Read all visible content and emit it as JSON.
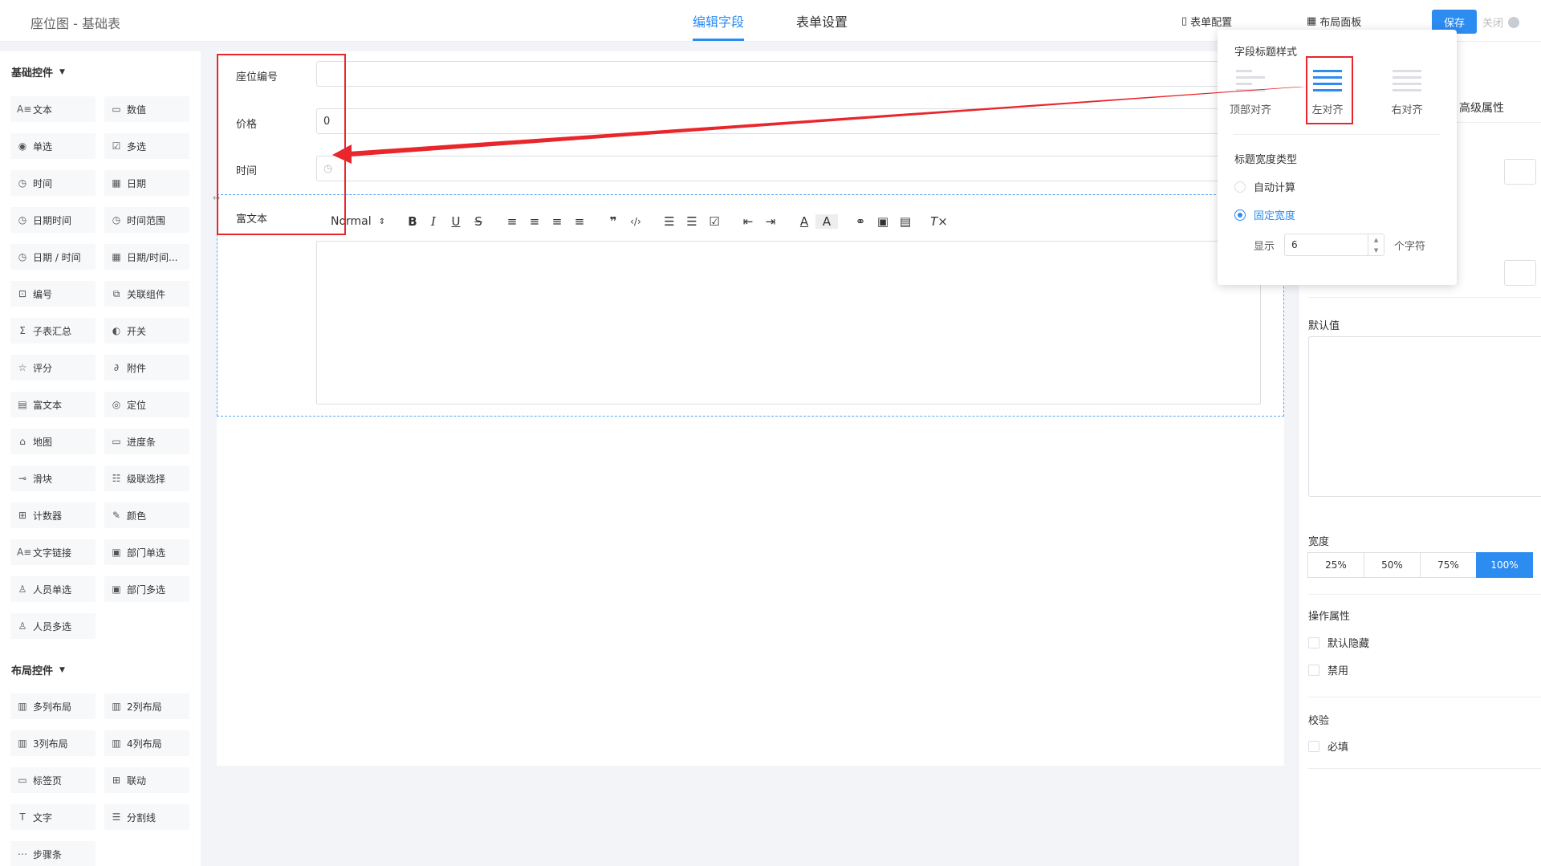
{
  "header": {
    "title": "座位图 - 基础表",
    "tabs": [
      "编辑字段",
      "表单设置"
    ],
    "form_config": "表单配置",
    "layout_panel": "布局面板",
    "save": "保存",
    "close": "关闭"
  },
  "sidebar": {
    "basic_group": "基础控件",
    "basic_items": [
      {
        "label": "文本",
        "icon": "text-icon"
      },
      {
        "label": "数值",
        "icon": "number-icon"
      },
      {
        "label": "单选",
        "icon": "radio-icon"
      },
      {
        "label": "多选",
        "icon": "checkbox-icon"
      },
      {
        "label": "时间",
        "icon": "clock-icon"
      },
      {
        "label": "日期",
        "icon": "calendar-icon"
      },
      {
        "label": "日期时间",
        "icon": "clock-icon"
      },
      {
        "label": "时间范围",
        "icon": "clock-icon"
      },
      {
        "label": "日期 / 时间",
        "icon": "clock-icon"
      },
      {
        "label": "日期/时间...",
        "icon": "calendar-icon"
      },
      {
        "label": "编号",
        "icon": "serial-icon"
      },
      {
        "label": "关联组件",
        "icon": "link-component-icon"
      },
      {
        "label": "子表汇总",
        "icon": "sigma-icon"
      },
      {
        "label": "开关",
        "icon": "toggle-icon"
      },
      {
        "label": "评分",
        "icon": "star-icon"
      },
      {
        "label": "附件",
        "icon": "paperclip-icon"
      },
      {
        "label": "富文本",
        "icon": "richtext-icon"
      },
      {
        "label": "定位",
        "icon": "location-icon"
      },
      {
        "label": "地图",
        "icon": "map-icon"
      },
      {
        "label": "进度条",
        "icon": "progress-icon"
      },
      {
        "label": "滑块",
        "icon": "slider-icon"
      },
      {
        "label": "级联选择",
        "icon": "cascade-icon"
      },
      {
        "label": "计数器",
        "icon": "counter-icon"
      },
      {
        "label": "颜色",
        "icon": "color-picker-icon"
      },
      {
        "label": "文字链接",
        "icon": "text-link-icon"
      },
      {
        "label": "部门单选",
        "icon": "department-icon"
      },
      {
        "label": "人员单选",
        "icon": "user-icon"
      },
      {
        "label": "部门多选",
        "icon": "department-icon"
      },
      {
        "label": "人员多选",
        "icon": "users-icon"
      }
    ],
    "layout_group": "布局控件",
    "layout_items": [
      {
        "label": "多列布局",
        "icon": "columns-icon"
      },
      {
        "label": "2列布局",
        "icon": "columns-icon"
      },
      {
        "label": "3列布局",
        "icon": "columns-icon"
      },
      {
        "label": "4列布局",
        "icon": "columns-icon"
      },
      {
        "label": "标签页",
        "icon": "tabs-icon"
      },
      {
        "label": "联动",
        "icon": "linkage-icon"
      },
      {
        "label": "文字",
        "icon": "text-t-icon"
      },
      {
        "label": "分割线",
        "icon": "divider-icon"
      },
      {
        "label": "步骤条",
        "icon": "steps-icon"
      }
    ]
  },
  "form": {
    "fields": [
      {
        "label": "座位编号",
        "value": ""
      },
      {
        "label": "价格",
        "value": "0"
      },
      {
        "label": "时间",
        "value": ""
      }
    ],
    "rich_text_label": "富文本",
    "rich_text_format": "Normal"
  },
  "popover": {
    "title_style": "字段标题样式",
    "align_options": [
      "顶部对齐",
      "左对齐",
      "右对齐"
    ],
    "selected_align": "左对齐",
    "width_type_title": "标题宽度类型",
    "width_type_options": [
      "自动计算",
      "固定宽度"
    ],
    "selected_width_type": "固定宽度",
    "display_label": "显示",
    "display_value": "6",
    "unit": "个字符"
  },
  "right_panel": {
    "tab": "高级属性",
    "default_value": "默认值",
    "width_title": "宽度",
    "width_options": [
      "25%",
      "50%",
      "75%",
      "100%"
    ],
    "width_selected": "100%",
    "ops_title": "操作属性",
    "ops": [
      "默认隐藏",
      "禁用"
    ],
    "validation_title": "校验",
    "validation": [
      "必填"
    ]
  },
  "colors": {
    "accent": "#2d8cf0",
    "annotation": "#e8262c"
  }
}
